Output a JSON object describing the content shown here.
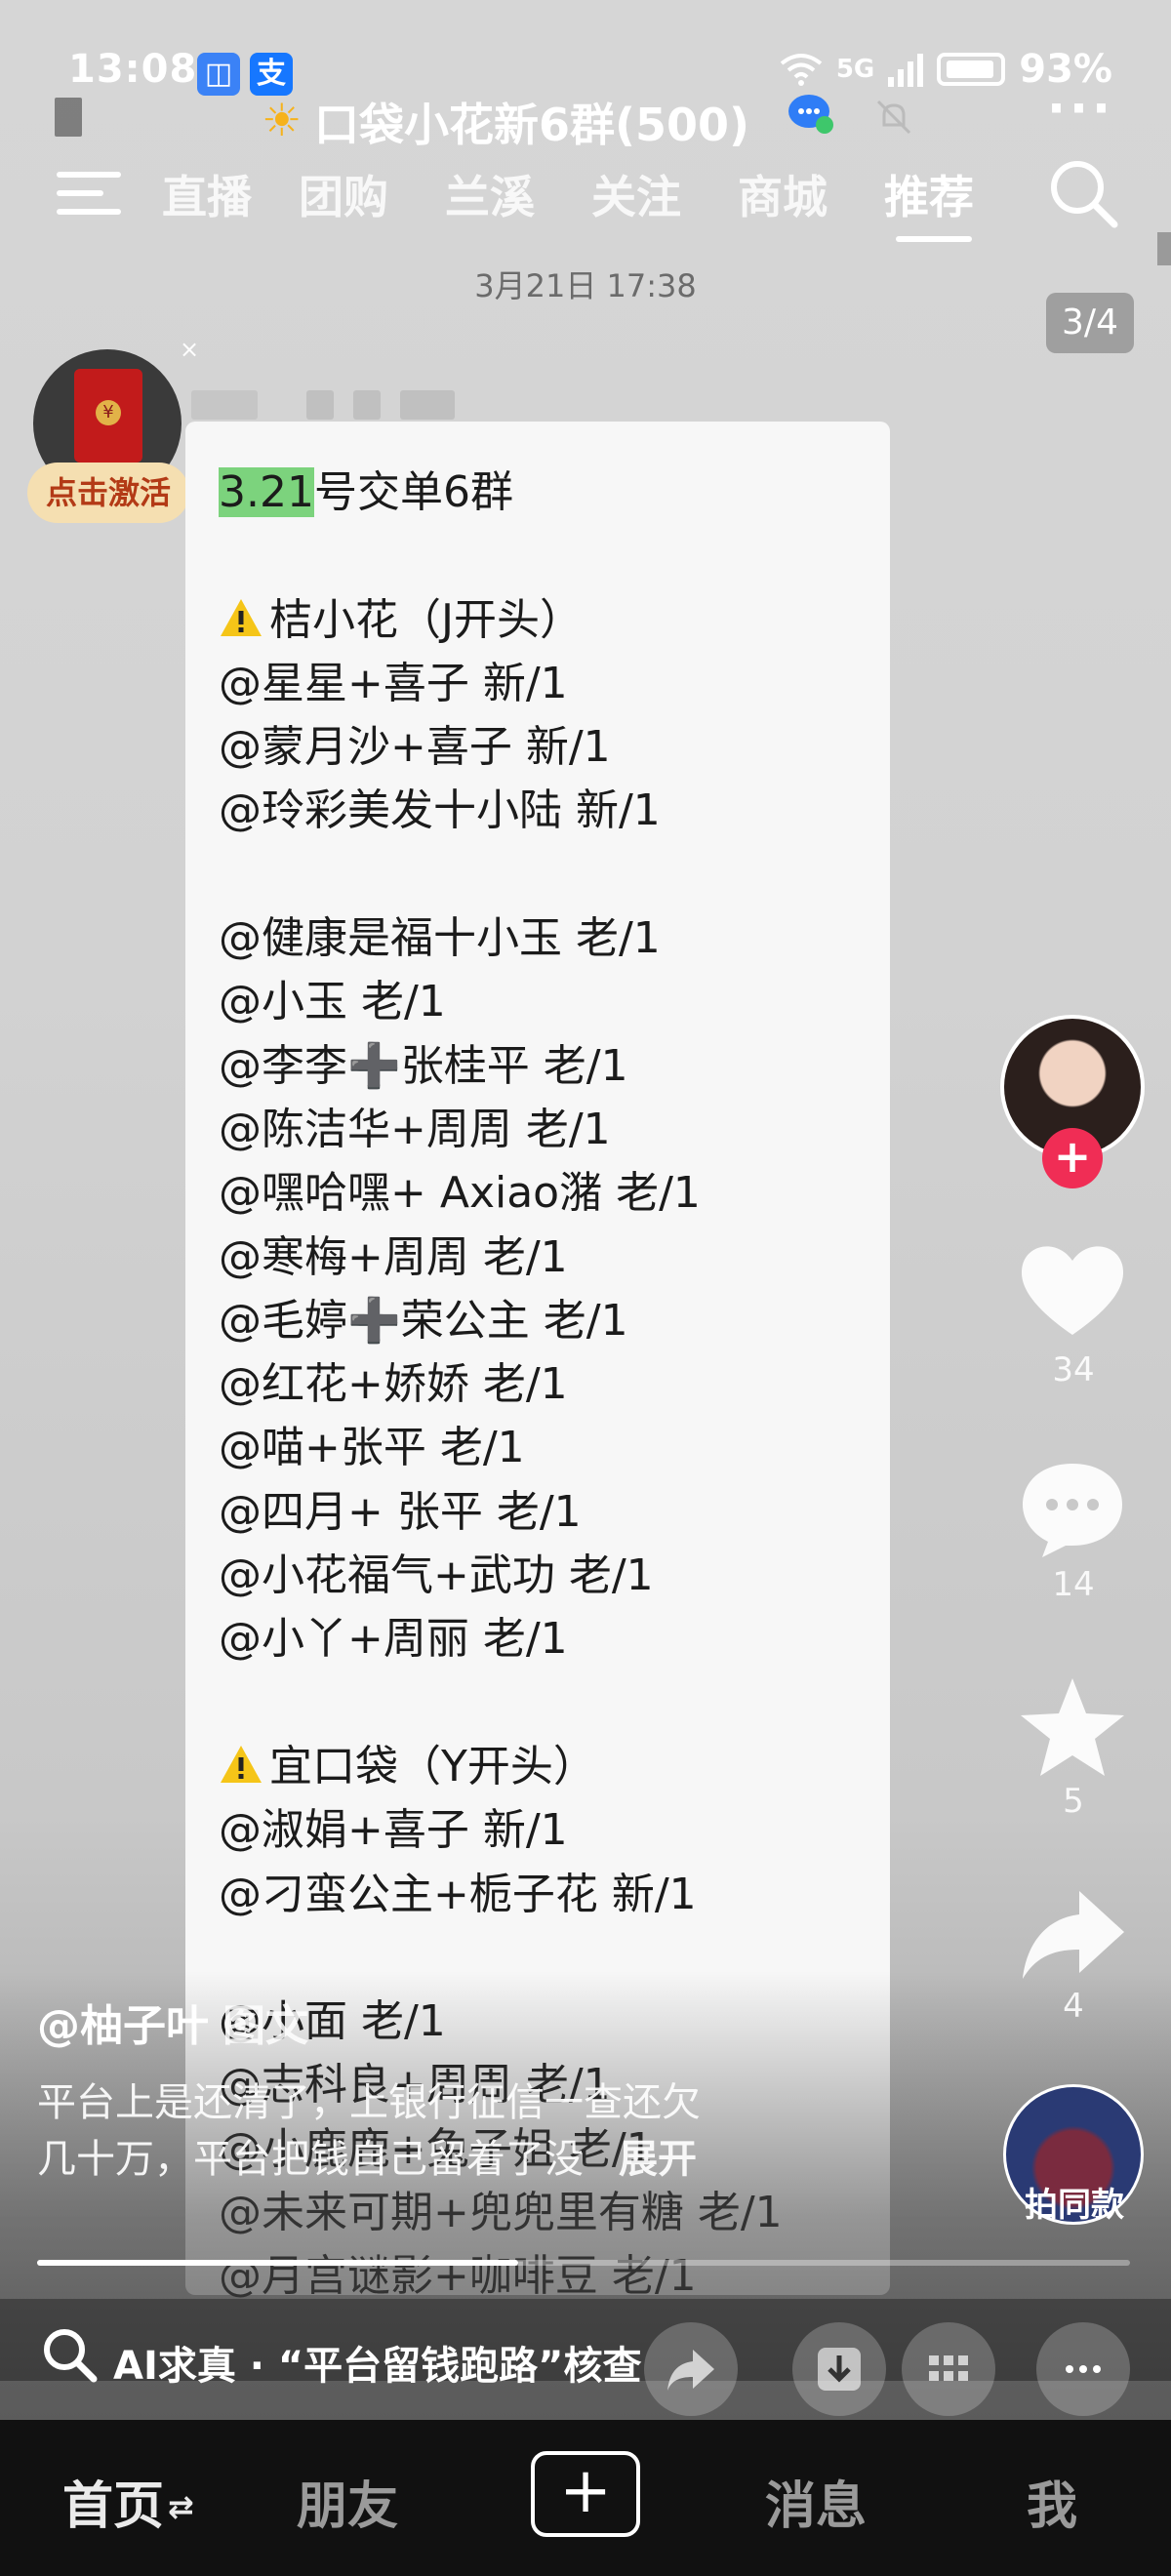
{
  "status_bar": {
    "time": "13:08",
    "app_badges": [
      "⬚",
      "支"
    ],
    "network": "5G",
    "battery": "93%"
  },
  "chat": {
    "title": "口袋小花新6群(500)",
    "date": "3月21日 17:38",
    "page_indicator": "3/4"
  },
  "feed_tabs": {
    "items": [
      "直播",
      "团购",
      "兰溪",
      "关注",
      "商城",
      "推荐"
    ],
    "active": "推荐"
  },
  "red_packet": {
    "label": "点击激活"
  },
  "message": {
    "lines": [
      "3.21号交单6群",
      "",
      "桔小花（J开头）",
      "@星星+喜子 新/1",
      "@蒙月沙+喜子 新/1",
      "@玲彩美发十小陆 新/1",
      "",
      "@健康是福十小玉 老/1",
      "@小玉 老/1",
      "@李李➕张桂平 老/1",
      "@陈洁华+周周 老/1",
      "@嘿哈嘿+ Axiao潴 老/1",
      "@寒梅+周周 老/1",
      "@毛婷➕荣公主 老/1",
      "@红花+娇娇 老/1",
      "@喵+张平 老/1",
      "@四月+ 张平 老/1",
      "@小花福气+武功 老/1",
      "@小丫+周丽 老/1",
      "",
      "宜口袋（Y开头）",
      " @淑娟+喜子 新/1",
      "@刁蛮公主+栀子花 新/1",
      "",
      "@小面 老/1",
      "@志科良+周周 老/1",
      "@小鹿鹿+兔子姐 老/1",
      "@未来可期+兜兜里有糖 老/1",
      "@月宫谜影+咖啡豆 老/1"
    ]
  },
  "post": {
    "author": "@柚子叶",
    "type_tag": "图文",
    "caption_line1": "平台上是还清了，上银行征信一查还欠",
    "caption_line2": "几十万，平台把钱自己留着了没",
    "expand": "展开",
    "progress": 0.44
  },
  "rail": {
    "likes": "34",
    "comments": "14",
    "favorites": "5",
    "shares": "4",
    "remix_label": "拍同款"
  },
  "ai_bar": {
    "text": "AI求真 · “平台留钱跑路”核查"
  },
  "bottom_nav": {
    "home": "首页",
    "friends": "朋友",
    "add": "+",
    "messages": "消息",
    "me": "我"
  },
  "colors": {
    "highlight": "#7cd37d",
    "follow": "#f02d55",
    "nav_bg": "#111111"
  }
}
